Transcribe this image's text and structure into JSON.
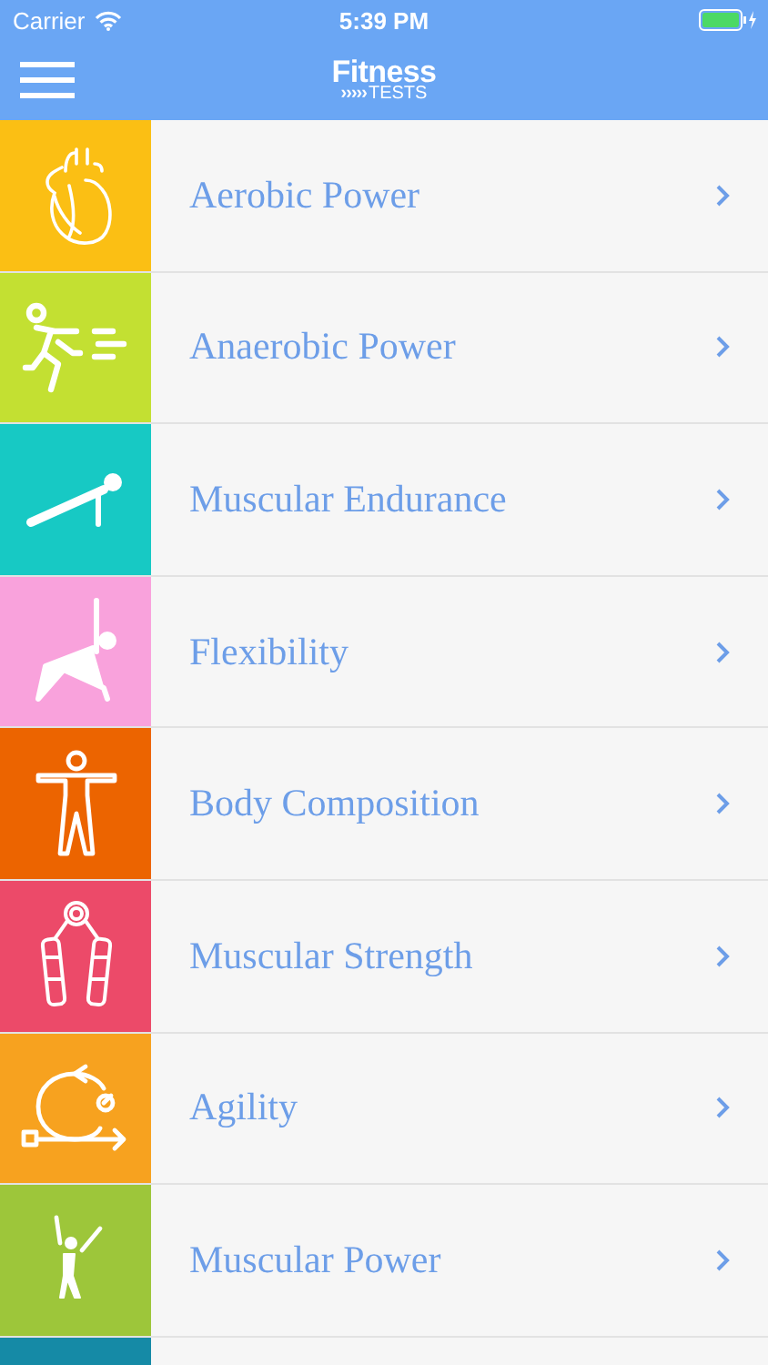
{
  "status_bar": {
    "carrier": "Carrier",
    "time": "5:39 PM"
  },
  "nav_bar": {
    "logo_top": "Fitness",
    "logo_bottom": "TESTS",
    "logo_arrows": "›››››"
  },
  "tests": [
    {
      "label": "Aerobic Power",
      "kind": "heart",
      "color": "#fbbf14"
    },
    {
      "label": "Anaerobic Power",
      "kind": "runner",
      "color": "#c3e032"
    },
    {
      "label": "Muscular Endurance",
      "kind": "plank",
      "color": "#17c9c4"
    },
    {
      "label": "Flexibility",
      "kind": "stretch",
      "color": "#f9a2dc"
    },
    {
      "label": "Body Composition",
      "kind": "body",
      "color": "#ec6400"
    },
    {
      "label": "Muscular Strength",
      "kind": "gripper",
      "color": "#ec4a69"
    },
    {
      "label": "Agility",
      "kind": "agility",
      "color": "#f7a21f"
    },
    {
      "label": "Muscular Power",
      "kind": "jump",
      "color": "#9dc63a"
    },
    {
      "kind": "partial",
      "color": "#158aa6"
    }
  ]
}
